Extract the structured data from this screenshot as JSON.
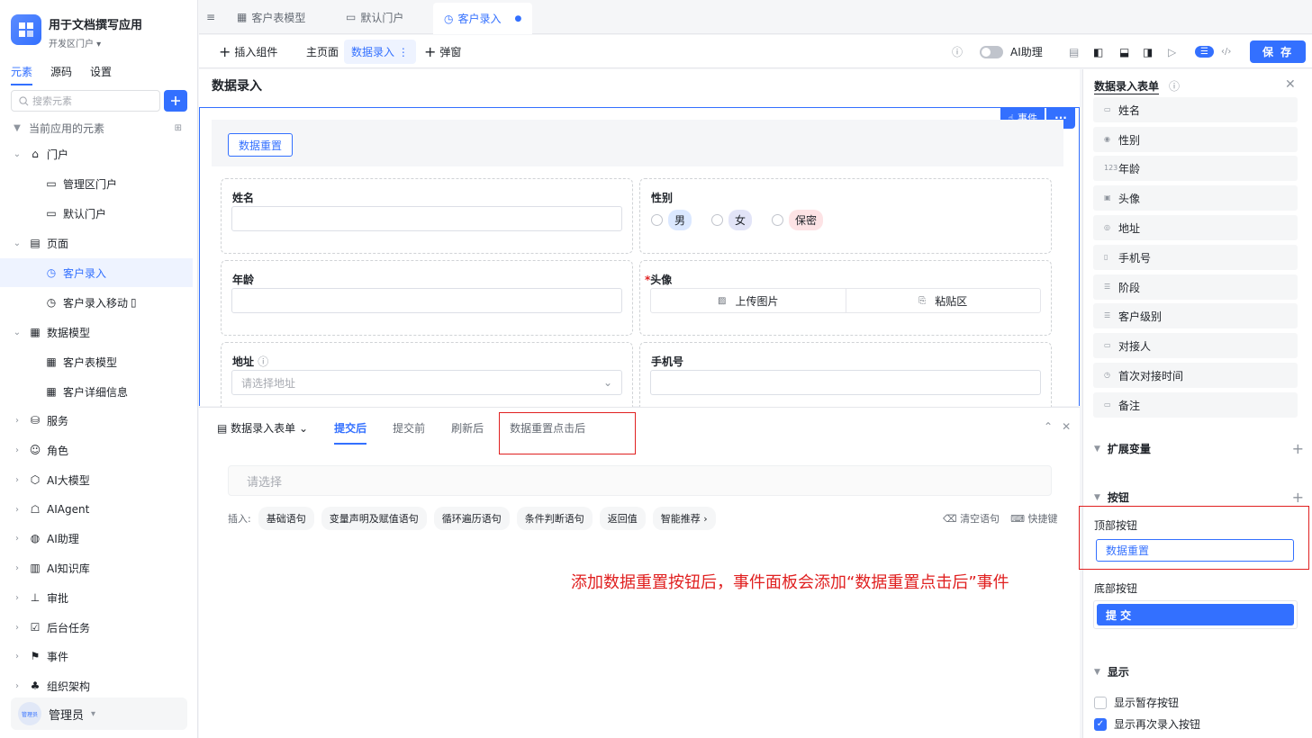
{
  "app": {
    "title": "用于文档撰写应用",
    "subtitle": "开发区门户"
  },
  "left_tabs": [
    "元素",
    "源码",
    "设置"
  ],
  "search": {
    "placeholder": "搜索元素"
  },
  "tree": {
    "header": "当前应用的元素",
    "items": [
      {
        "label": "门户"
      },
      {
        "label": "管理区门户"
      },
      {
        "label": "默认门户"
      },
      {
        "label": "页面"
      },
      {
        "label": "客户录入"
      },
      {
        "label": "客户录入移动"
      },
      {
        "label": "数据模型"
      },
      {
        "label": "客户表模型"
      },
      {
        "label": "客户详细信息"
      },
      {
        "label": "服务"
      },
      {
        "label": "角色"
      },
      {
        "label": "AI大模型"
      },
      {
        "label": "AIAgent"
      },
      {
        "label": "AI助理"
      },
      {
        "label": "AI知识库"
      },
      {
        "label": "审批"
      },
      {
        "label": "后台任务"
      },
      {
        "label": "事件"
      },
      {
        "label": "组织架构"
      }
    ]
  },
  "user": {
    "name": "管理员",
    "avatar_text": "管理员"
  },
  "top_tabs": [
    {
      "label": "客户表模型"
    },
    {
      "label": "默认门户"
    },
    {
      "label": "客户录入"
    }
  ],
  "toolbar": {
    "insert": "插入组件",
    "main_page": "主页面",
    "data_entry": "数据录入",
    "popup": "弹窗",
    "ai_assistant": "AI助理",
    "save": "保 存"
  },
  "canvas": {
    "page_title": "数据录入",
    "event_btn": "事件",
    "reset_btn": "数据重置",
    "fields": {
      "name": "姓名",
      "gender": "性别",
      "age": "年龄",
      "avatar": "头像",
      "address": "地址",
      "address_placeholder": "请选择地址",
      "phone": "手机号",
      "upload": "上传图片",
      "paste": "粘贴区"
    },
    "gender_options": [
      "男",
      "女",
      "保密"
    ]
  },
  "events": {
    "form_select": "数据录入表单",
    "tabs": [
      "提交后",
      "提交前",
      "刷新后",
      "数据重置点击后"
    ],
    "select_placeholder": "请选择",
    "insert_label": "插入:",
    "insert_chips": [
      "基础语句",
      "变量声明及赋值语句",
      "循环遍历语句",
      "条件判断语句",
      "返回值",
      "智能推荐"
    ],
    "clear": "清空语句",
    "shortcut": "快捷键",
    "annotation": "添加数据重置按钮后，事件面板会添加“数据重置点击后”事件"
  },
  "right": {
    "title": "数据录入表单",
    "items": [
      "姓名",
      "性别",
      "年龄",
      "头像",
      "地址",
      "手机号",
      "阶段",
      "客户级别",
      "对接人",
      "首次对接时间",
      "备注"
    ],
    "item_icons": [
      "▭",
      "◉",
      "123",
      "▣",
      "◎",
      "▯",
      "☰",
      "☰",
      "▭",
      "◷",
      "▭"
    ],
    "ext_vars": "扩展变量",
    "buttons": "按钮",
    "top_buttons": "顶部按钮",
    "top_button_value": "数据重置",
    "bottom_buttons": "底部按钮",
    "bottom_button_value": "提 交",
    "display": "显示",
    "show_draft": "显示暂存按钮",
    "show_again": "显示再次录入按钮"
  },
  "colors": {
    "accent": "#3370ff",
    "annotation": "#e02020"
  }
}
